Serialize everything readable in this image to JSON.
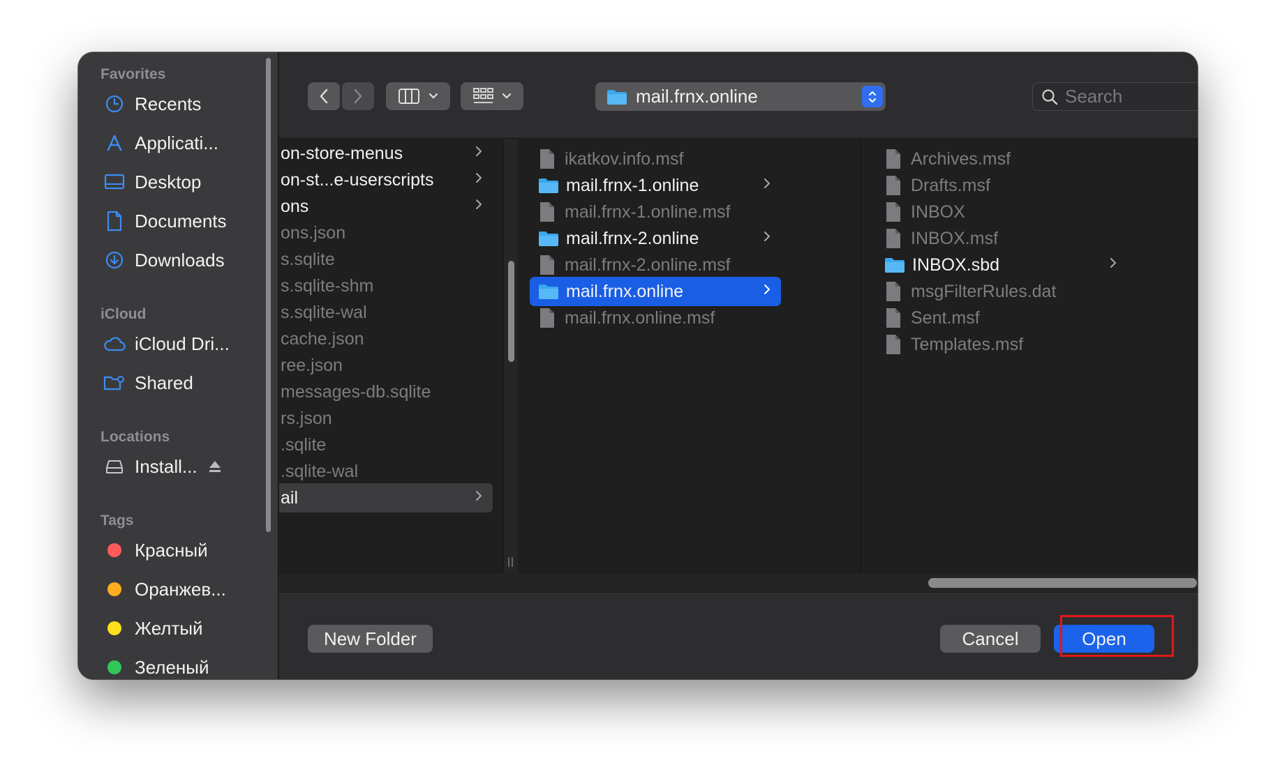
{
  "sidebar": {
    "sections": {
      "favorites": "Favorites",
      "icloud": "iCloud",
      "locations": "Locations",
      "tags": "Tags"
    },
    "favorites": [
      {
        "label": "Recents",
        "icon": "clock-icon"
      },
      {
        "label": "Applicati...",
        "icon": "applications-icon"
      },
      {
        "label": "Desktop",
        "icon": "desktop-icon"
      },
      {
        "label": "Documents",
        "icon": "document-icon"
      },
      {
        "label": "Downloads",
        "icon": "download-icon"
      }
    ],
    "icloud": [
      {
        "label": "iCloud Dri...",
        "icon": "cloud-icon"
      },
      {
        "label": "Shared",
        "icon": "shared-folder-icon"
      }
    ],
    "locations": [
      {
        "label": "Install...",
        "icon": "disk-icon"
      }
    ],
    "tags": [
      {
        "label": "Красный",
        "color": "#ff5b5b"
      },
      {
        "label": "Оранжев...",
        "color": "#ffad1f"
      },
      {
        "label": "Желтый",
        "color": "#ffe01a"
      },
      {
        "label": "Зеленый",
        "color": "#33c759"
      }
    ]
  },
  "toolbar": {
    "path_label": "mail.frnx.online",
    "search_placeholder": "Search"
  },
  "columns": {
    "col1": [
      {
        "name": "on-store-menus",
        "type": "folder",
        "chevron": true,
        "dim": false
      },
      {
        "name": "on-st...e-userscripts",
        "type": "folder",
        "chevron": true,
        "dim": false
      },
      {
        "name": "ons",
        "type": "folder",
        "chevron": true,
        "dim": false
      },
      {
        "name": "ons.json",
        "type": "file",
        "dim": true
      },
      {
        "name": "s.sqlite",
        "type": "file",
        "dim": true
      },
      {
        "name": "s.sqlite-shm",
        "type": "file",
        "dim": true
      },
      {
        "name": "s.sqlite-wal",
        "type": "file",
        "dim": true
      },
      {
        "name": "cache.json",
        "type": "file",
        "dim": true
      },
      {
        "name": "ree.json",
        "type": "file",
        "dim": true
      },
      {
        "name": "messages-db.sqlite",
        "type": "file",
        "dim": true
      },
      {
        "name": "rs.json",
        "type": "file",
        "dim": true
      },
      {
        "name": ".sqlite",
        "type": "file",
        "dim": true
      },
      {
        "name": ".sqlite-wal",
        "type": "file",
        "dim": true
      },
      {
        "name": "ail",
        "type": "folder",
        "chevron": true,
        "dim": false,
        "highlight": true
      }
    ],
    "col2": [
      {
        "name": "ikatkov.info.msf",
        "type": "file",
        "dim": true
      },
      {
        "name": "mail.frnx-1.online",
        "type": "folder",
        "chevron": true,
        "dim": false
      },
      {
        "name": "mail.frnx-1.online.msf",
        "type": "file",
        "dim": true
      },
      {
        "name": "mail.frnx-2.online",
        "type": "folder",
        "chevron": true,
        "dim": false
      },
      {
        "name": "mail.frnx-2.online.msf",
        "type": "file",
        "dim": true
      },
      {
        "name": "mail.frnx.online",
        "type": "folder",
        "chevron": true,
        "dim": false,
        "selected": true
      },
      {
        "name": "mail.frnx.online.msf",
        "type": "file",
        "dim": true
      }
    ],
    "col3": [
      {
        "name": "Archives.msf",
        "type": "file",
        "dim": true
      },
      {
        "name": "Drafts.msf",
        "type": "file",
        "dim": true
      },
      {
        "name": "INBOX",
        "type": "file",
        "dim": true
      },
      {
        "name": "INBOX.msf",
        "type": "file",
        "dim": true
      },
      {
        "name": "INBOX.sbd",
        "type": "folder",
        "chevron": true,
        "dim": false
      },
      {
        "name": "msgFilterRules.dat",
        "type": "file",
        "dim": true
      },
      {
        "name": "Sent.msf",
        "type": "file",
        "dim": true
      },
      {
        "name": "Templates.msf",
        "type": "file",
        "dim": true
      }
    ]
  },
  "footer": {
    "new_folder": "New Folder",
    "cancel": "Cancel",
    "open": "Open"
  }
}
